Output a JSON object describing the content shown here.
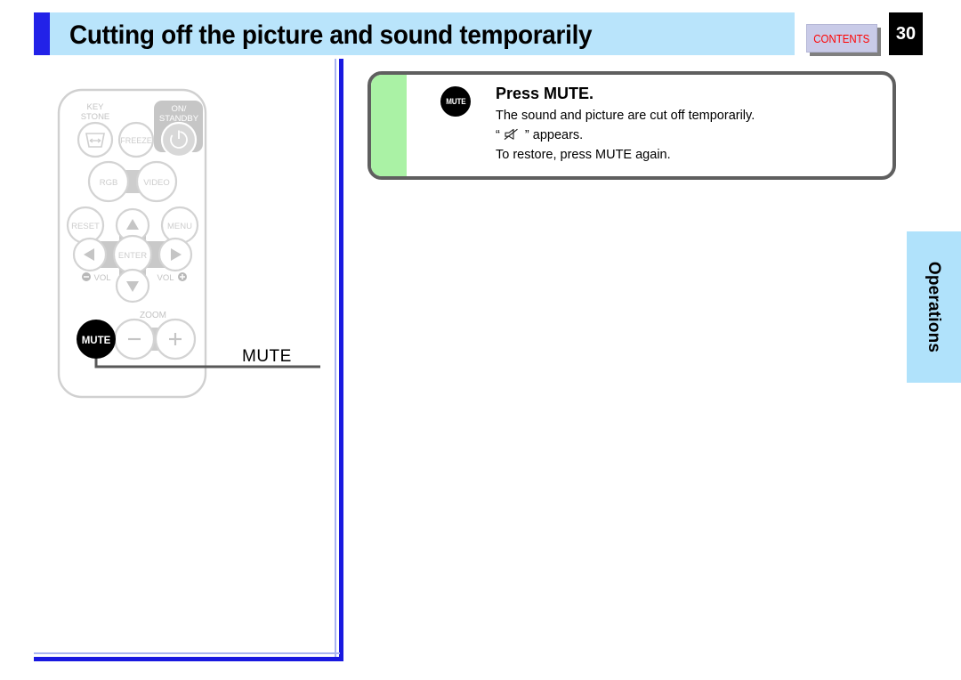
{
  "header": {
    "title": "Cutting off the picture and sound temporarily",
    "contents_label": "CONTENTS",
    "page_number": "30",
    "accent_color": "#2222e8",
    "band_color": "#b9e4fb",
    "contents_text_color": "#ff0000"
  },
  "side_tab": {
    "label": "Operations",
    "color": "#b0e2fb"
  },
  "panel": {
    "badge_label": "MUTE",
    "heading": "Press MUTE.",
    "line1": "The sound and picture are cut off temporarily.",
    "line2_prefix": "“",
    "line2_suffix": "” appears.",
    "line3": "To restore, press MUTE again.",
    "stripe_color": "#aaf2a5",
    "border_color": "#5f5f5f",
    "mute_icon": "speaker-muted-icon"
  },
  "callout": {
    "label": "MUTE",
    "line_color": "#585858"
  },
  "remote": {
    "body_color": "#ffffff",
    "outline_color": "#cfcfcf",
    "button_color": "#d2d2d2",
    "highlight_color": "#000000",
    "labels": {
      "keystone_line1": "KEY",
      "keystone_line2": "STONE",
      "freeze": "FREEZE",
      "onstandby_line1": "ON/",
      "onstandby_line2": "STANDBY",
      "rgb": "RGB",
      "video": "VIDEO",
      "reset": "RESET",
      "menu": "MENU",
      "enter": "ENTER",
      "vol_down": "VOL",
      "vol_up": "VOL",
      "zoom": "ZOOM",
      "mute": "MUTE",
      "zoom_minus": "−",
      "zoom_plus": "+"
    }
  }
}
